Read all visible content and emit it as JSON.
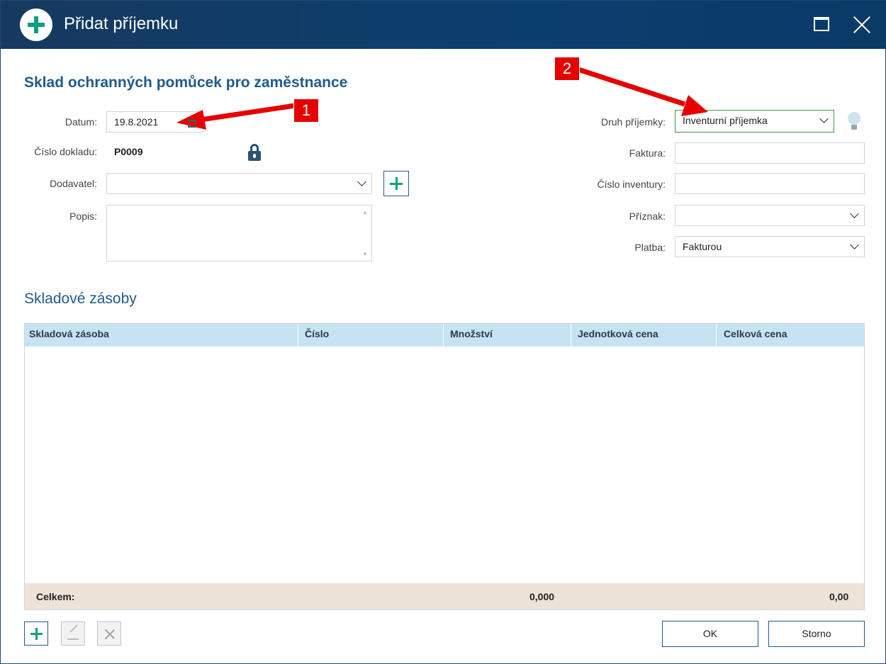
{
  "window": {
    "title": "Přidat příjemku",
    "icons": [
      "add-circle-icon",
      "maximize-icon",
      "close-icon"
    ]
  },
  "form": {
    "heading": "Sklad ochranných pomůcek pro zaměstnance",
    "datum": {
      "label": "Datum:",
      "value": "19.8.2021"
    },
    "cislo_dokladu": {
      "label": "Číslo dokladu:",
      "value": "P0009"
    },
    "dodavatel": {
      "label": "Dodavatel:",
      "value": ""
    },
    "popis": {
      "label": "Popis:",
      "value": ""
    },
    "druh_prijemky": {
      "label": "Druh příjemky:",
      "value": "Inventurní příjemka"
    },
    "faktura": {
      "label": "Faktura:",
      "value": ""
    },
    "cislo_inventury": {
      "label": "Číslo inventury:",
      "value": ""
    },
    "priznak": {
      "label": "Příznak:",
      "value": ""
    },
    "platba": {
      "label": "Platba:",
      "value": "Fakturou"
    }
  },
  "stock": {
    "section_title": "Skladové zásoby",
    "columns": [
      "Skladová zásoba",
      "Číslo",
      "Množství",
      "Jednotková cena",
      "Celková cena"
    ],
    "rows": [],
    "footer": {
      "label": "Celkem:",
      "quantity_total": "0,000",
      "price_total": "0,00"
    }
  },
  "buttons": {
    "ok": "OK",
    "cancel": "Storno"
  },
  "callouts": {
    "one": "1",
    "two": "2"
  },
  "colors": {
    "titlebar": "#0b3f70",
    "accent": "#0f9e80",
    "heading": "#1f5a8a",
    "grid_header": "#c6e3f4",
    "grid_footer": "#ede3d8",
    "callout": "#e60000"
  }
}
